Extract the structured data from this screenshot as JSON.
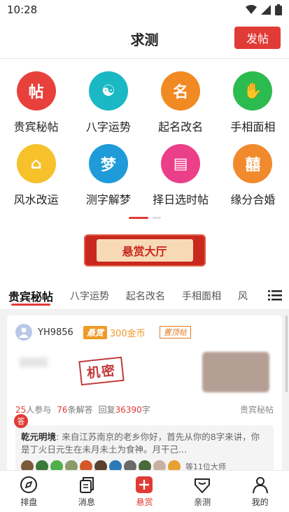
{
  "status": {
    "time": "10:28"
  },
  "header": {
    "title": "求测",
    "post_label": "发帖"
  },
  "categories": [
    {
      "label": "贵宾秘帖",
      "color": "#e8413c",
      "glyph": "帖"
    },
    {
      "label": "八字运势",
      "color": "#19b8c4",
      "glyph": "☯"
    },
    {
      "label": "起名改名",
      "color": "#f28a24",
      "glyph": "名"
    },
    {
      "label": "手相面相",
      "color": "#2bbb4f",
      "glyph": "✋"
    },
    {
      "label": "风水改运",
      "color": "#f6c12a",
      "glyph": "⌂"
    },
    {
      "label": "测字解梦",
      "color": "#1e9bd8",
      "glyph": "梦"
    },
    {
      "label": "择日选时帖",
      "color": "#ec3f8a",
      "glyph": "▤"
    },
    {
      "label": "缘分合婚",
      "color": "#f08a2c",
      "glyph": "囍"
    }
  ],
  "banner": {
    "label": "悬赏大厅"
  },
  "tabs": [
    "贵宾秘帖",
    "八字运势",
    "起名改名",
    "手相面相",
    "风"
  ],
  "post": {
    "user": "YH9856",
    "reward_tag": "悬赏",
    "reward_value": "300金币",
    "top_tag": "置顶帖",
    "secret_stamp": "机密",
    "participants": "25",
    "participants_label": "人参与",
    "answers": "76",
    "answers_label": "条解答",
    "reply_label": "回复",
    "reply_chars": "36390",
    "reply_unit": "字",
    "category": "贵宾秘帖",
    "answer_badge": "答",
    "answer_author": "乾元明境",
    "answer_text": ": 来自江苏南京的老乡你好，首先从你的8字来讲，你是丁火日元生在未月未土为食神。月干己...",
    "masters_more": "等11位大师"
  },
  "bottom_nav": [
    {
      "label": "排盘"
    },
    {
      "label": "消息"
    },
    {
      "label": "悬赏"
    },
    {
      "label": "亲测"
    },
    {
      "label": "我的"
    }
  ]
}
